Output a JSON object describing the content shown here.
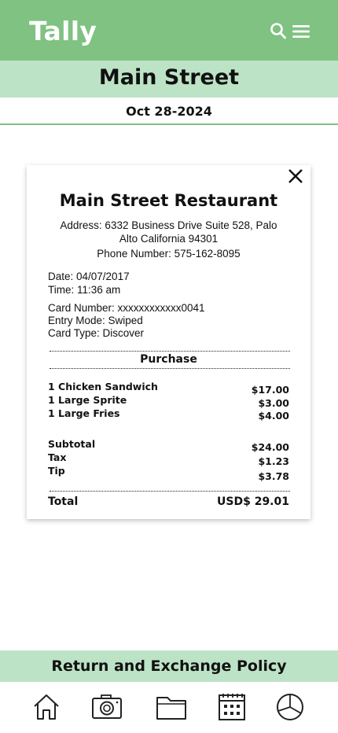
{
  "header": {
    "app_title": "Tally",
    "search_icon": "search-icon",
    "menu_icon": "hamburger-menu-icon",
    "color": "#7fc282"
  },
  "store": {
    "name": "Main Street",
    "date": "Oct 28-2024"
  },
  "receipt": {
    "title": "Main Street Restaurant",
    "address_line1": "Address: 6332 Business Drive Suite 528, Palo",
    "address_line2": "Alto California 94301",
    "phone": "Phone Number: 575-162-8095",
    "date": "Date: 04/07/2017",
    "time": "Time: 11:36 am",
    "card_number": "Card Number: xxxxxxxxxxxx0041",
    "entry_mode": "Entry Mode: Swiped",
    "card_type": "Card Type: Discover",
    "purchase_label": "Purchase",
    "items": [
      {
        "name": "1 Chicken Sandwich",
        "price": "$17.00"
      },
      {
        "name": "1 Large Sprite",
        "price": "$3.00"
      },
      {
        "name": "1 Large Fries",
        "price": "$4.00"
      }
    ],
    "summary": [
      {
        "label": "Subtotal",
        "value": "$24.00"
      },
      {
        "label": "Tax",
        "value": "$1.23"
      },
      {
        "label": "Tip",
        "value": "$3.78"
      }
    ],
    "total_label": "Total",
    "total_value": "USD$ 29.01"
  },
  "policy": {
    "label": "Return and Exchange Policy",
    "color": "#bde3c6"
  },
  "bottom_nav": {
    "items": [
      {
        "icon": "home-icon"
      },
      {
        "icon": "camera-icon"
      },
      {
        "icon": "folder-icon"
      },
      {
        "icon": "calendar-icon"
      },
      {
        "icon": "pie-chart-icon"
      }
    ]
  }
}
